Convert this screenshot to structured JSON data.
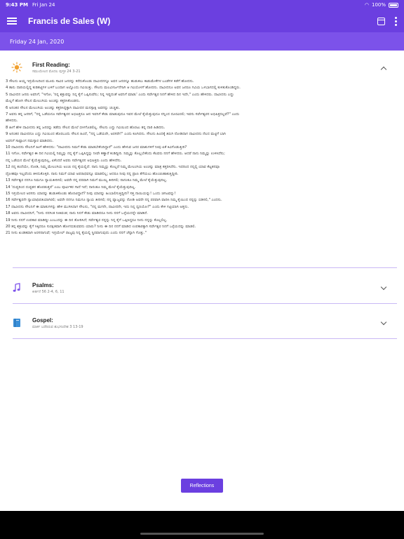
{
  "status": {
    "time": "9:43 PM",
    "date": "Fri Jan 24",
    "battery": "100%",
    "wifi": "◠"
  },
  "appbar": {
    "title": "Francis de Sales (W)"
  },
  "datebar": {
    "label": "Friday 24 Jan, 2020"
  },
  "sections": [
    {
      "title": "First Reading:",
      "subtitle": "ಸಮುಯೇಲನ ಮೊದಲ ಪುಸ್ತಕ 24 3-21",
      "expanded": true
    },
    {
      "title": "Psalms:",
      "subtitle": "ಕೀರ್ತನೆ 56 2-4, 6, 11",
      "expanded": false
    },
    {
      "title": "Gospel:",
      "subtitle": "ಮಾರ್ಕ ಬರೆದಿರುವ ಶುಭಸಂದೇಶ 3 13-19",
      "expanded": false
    }
  ],
  "reading_lines": [
    "3 ಸೌಲನು ಆಯ್ದ ಇಸ್ರಯೇಲರಿಂದ ಮೂರು ಸಾವಿರ ಜನರನ್ನು ಕರೆದುಕೊಂಡು ದಾವೀದನನ್ನೂ ಅವನ ಜನರನ್ನೂ ಹುಡುಕಲು ಕಾಡುಮೇಕೆಗಳ ಬಂಡೆಗಳ ಕಡೆಗೆ ಹೋದನು.",
    "4 ತಾನು ದಾರಿಯಲ್ಲಿದ್ದ ಕುರಿಹಟ್ಟಿಗಳ ಬಳಿಗೆ ಬಂದಾಗ ಅಲ್ಲೊಂದು ಗವಿಯಿತ್ತು. ಸೌಲನು ಮಲವಿಸರ್ಜನೆಗಾಗಿ ಆ ಗವಿಯೊಳಗೆ ಹೋದನು. ದಾವೀದನೂ ಅವನ ಜನರೂ ಗವಿಯ ಒಳಭಾಗದಲ್ಲಿ ಕುಳಿತುಕೊಂಡಿದ್ದರು.",
    "5 ದಾವೀದನ ಜನರು ಅವನಿಗೆ, \"ಇಗೋ, 'ನಿನ್ನ ಶತ್ರುವನ್ನು ನಿನ್ನ ಕೈಗೆ ಒಪ್ಪಿಸುವೆನು; ನಿನ್ನ ಇಷ್ಟದಂತೆ ಅವನಿಗೆ ಮಾಡು' ಎಂದು ಸರ್ವೇಶ್ವರ ನಿನಗೆ ಹೇಳಿದ ದಿನ ಇದೇ,\" ಎಂದು ಹೇಳಿದರು. ದಾವೀದನು ಎದ್ದು",
    "ಮೆಲ್ಲಗೆ ಹೋಗಿ ಸೌಲನ ಮೇಲಂಗಿಯ ಅಂಚನ್ನು ಕತ್ತರಿಸಿಕೊಂಡನು.",
    "6 ಅನಂತರ ಸೌಲನ ಮೇಲಂಗಿಯ ಅಂಚನ್ನು ಕತ್ತರಿಸಿದ್ದಕ್ಕಾಗಿ ದಾವೀದನ ಮನಸ್ಸಾಕ್ಷಿ ಅವನನ್ನು ಚುಚ್ಚಿತು.",
    "7 ಅವನು ತನ್ನ ಜನರಿಗೆ, \"ನನ್ನ ಒಡೆಯನೂ ಸರ್ವೇಶ್ವರನ ಅಭಿಷಿಕ್ತನೂ ಆದ ಇವನಿಗೆ ಕೇಡು ಮಾಡುವುದೂ ಇವನ ಮೇಲೆ ಕೈಯೆತ್ತುವುದೂ ನನ್ನಿಂದ ದೂರವಿರಲಿ; ಇವನು ಸರ್ವೇಶ್ವರನ ಅಭಿಷಿಕ್ತನಲ್ಲವೆ?\" ಎಂದು",
    "ಹೇಳಿದನು.",
    "8 ಹೀಗೆ ಹೇಳಿ ದಾವೀದನು ತನ್ನ ಜನರನ್ನು ತಡೆದು ಸೌಲನ ಮೇಲೆ ಬೀಳಗೊಡಲಿಲ್ಲ. ಸೌಲನು ಎದ್ದು ಗವಿಯಿಂದ ಹೊರಟು ತನ್ನ ದಾರಿ ಹಿಡಿದನು.",
    "9 ಅನಂತರ ದಾವೀದನೂ ಎದ್ದು ಗವಿಯಿಂದ ಹೊರಬಂದು ಸೌಲನ ಹಿಂದೆ, \"ನನ್ನ ಒಡೆಯರೇ, ಅರಸರೇ!\" ಎಂದು ಕೂಗಿದನು. ಸೌಲನು ಹಿಂದಕ್ಕೆ ತಿರುಗಿ ನೋಡಿದಾಗ ದಾವೀದನು ನೆಲದ ಮಟ್ಟಿಗೆ ಬಾಗಿ",
    "ಅವನಿಗೆ ಸಾಷ್ಟಾಂಗ ನಮಸ್ಕಾರ ಮಾಡಿದನು.",
    "10 ದಾವೀದನು ಸೌಲನಿಗೆ ಹೀಗೆ ಹೇಳಿದನು: \"ದಾವೀದನು ನಿಮಗೆ ಕೇಡು ಮಾಡಬೇಕೆಂದಿದ್ದಾನೆ\" ಎಂದು ಹೇಳುವ ಜನರ ಮಾತುಗಳಿಗೆ ನೀವು ಏಕೆ ಕಿವಿಗೊಡುತ್ತೀರಿ?",
    "11 ಇಗೋ, ಸರ್ವೇಶ್ವರ ಈ ದಿನ ಗವಿಯಲ್ಲಿ ನಿಮ್ಮನ್ನು ನನ್ನ ಕೈಗೆ ಒಪ್ಪಿಸಿದ್ದನ್ನು ನೀವೇ ಕಣ್ಣಾರೆ ಕಂಡಿದ್ದೀರಿ. ನಿಮ್ಮನ್ನು ಕೊಲ್ಲಬೇಕೆಂದು ಕೆಲವರು ನನಗೆ ಹೇಳಿದರು. ಆದರೆ ನಾನು ನಿಮ್ಮನ್ನು ಉಳಿಸಿದೆನು;",
    "ನನ್ನ ಒಡೆಯನ ಮೇಲೆ ಕೈಯೆತ್ತುವುದಿಲ್ಲ, ಏಕೆಂದರೆ ಅವರು ಸರ್ವೇಶ್ವರನ ಅಭಿಷಿಕ್ತರು ಎಂದು ಹೇಳಿದೆನು.",
    "12 ನನ್ನ ತಂದೆಯೇ, ನೋಡಿ, ನಿಮ್ಮ ಮೇಲಂಗಿಯ ಅಂಚು ನನ್ನ ಕೈಯಲ್ಲಿದೆ. ನಾನು ನಿಮ್ಮನ್ನು ಕೊಲ್ಲದೆ ನಿಮ್ಮ ಮೇಲಂಗಿಯ ಅಂಚನ್ನು ಮಾತ್ರ ಕತ್ತರಿಸಿದೆನು. ಇದರಿಂದ ನನ್ನಲ್ಲಿ ಯಾವ ಕೆಟ್ಟತನವೂ",
    "ದ್ರೋಹವೂ ಇಲ್ಲವೆಂದು ತಿಳಿದುಕೊಳ್ಳಿರಿ. ನಾನು ನಿಮಗೆ ಯಾವ ಅಪರಾಧವನ್ನೂ ಮಾಡಲಿಲ್ಲ; ಆದರೂ ನೀವು ನನ್ನ ಪ್ರಾಣ ತೆಗೆಯಲು ಹೊಂಚುಹಾಕುತ್ತಿದ್ದೀರಿ.",
    "13 ಸರ್ವೇಶ್ವರ ನನಗೂ ನಿಮಗೂ ನ್ಯಾಯತೀರಿಸಲಿ; ಅವರೇ ನನ್ನ ಪರವಾಗಿ ನಿಮಗೆ ಮುಯ್ಯಿ ತೀರಿಸಲಿ; ನಾನಂತೂ ನಿಮ್ಮ ಮೇಲೆ ಕೈಯೆತ್ತುವುದಿಲ್ಲ.",
    "14 'ದುಷ್ಟರಿಂದ ದುಷ್ಟತನ ಹೊರಡುತ್ತದೆ' ಎಂಬ ಪೂರ್ವಿಕರ ಗಾದೆ ಇದೆ; ನಾನಂತೂ ನಿಮ್ಮ ಮೇಲೆ ಕೈಯೆತ್ತುವುದಿಲ್ಲ.",
    "15 ಇಸ್ರಯೇಲರ ಅರಸನು ಯಾರನ್ನು ಹುಡುಕಿಕೊಂಡು ಹೊರಟಿದ್ದಾನೆ? ನೀವು ಯಾರನ್ನು ಹಿಂಬಾಲಿಸುತ್ತಿದ್ದೀರಿ? ಸತ್ತ ನಾಯಿಯನ್ನು! ಒಂದು ಚಿಗಟವನ್ನು!",
    "16 ಸರ್ವೇಶ್ವರನೇ ನ್ಯಾಯಾಧಿಪತಿಯಾಗಿರಲಿ; ಅವರೇ ನನಗೂ ನಿಮಗೂ ನ್ಯಾಯ ತೀರಿಸಲಿ; ನನ್ನ ವ್ಯಾಜ್ಯವನ್ನು ನೋಡಿ ಅವರೇ ನನ್ನ ಪರವಾಗಿ ವಾದಿಸಿ ನಿಮ್ಮ ಕೈಯಿಂದ ನನ್ನನ್ನು ಬಿಡಿಸಲಿ,\" ಎಂದನು.",
    "17 ದಾವೀದನು ಸೌಲನಿಗೆ ಈ ಮಾತುಗಳನ್ನು ಹೇಳಿ ಮುಗಿಸಿದಾಗ ಸೌಲನು, \"ನನ್ನ ಮಗನೇ, ದಾವೀದನೇ, ಇದು ನಿನ್ನ ಧ್ವನಿಯೋ?\" ಎಂದು ಕೇಳಿ ಗಟ್ಟಿಯಾಗಿ ಅತ್ತನು.",
    "18 ಅವನು ದಾವೀದನಿಗೆ, \"ನೀನು ನನಗಿಂತ ನೀತಿವಂತ; ನಾನು ನಿನಗೆ ಕೇಡು ಮಾಡಿದರೂ ನೀನು ನನಗೆ ಒಳ್ಳೆಯದನ್ನೇ ಮಾಡಿದೆ.",
    "19 ನೀನು ನನಗೆ ಉಪಕಾರ ಮಾಡಿದ್ದೀ ಎಂಬುದನ್ನು ಈ ದಿನ ತೋರಿಸಿದೆ; ಸರ್ವೇಶ್ವರ ನನ್ನನ್ನು ನಿನ್ನ ಕೈಗೆ ಒಪ್ಪಿಸಿದ್ದರೂ ನೀನು ನನ್ನನ್ನು ಕೊಲ್ಲಲಿಲ್ಲ.",
    "20 ತನ್ನ ಶತ್ರುವನ್ನು ಕೈಗೆ ಸಿಕ್ಕಿದರೂ ಸುರಕ್ಷಿತವಾಗಿ ಹೋಗಬಿಡುವವನು ಯಾರು? ನೀನು ಈ ದಿನ ನನಗೆ ಮಾಡಿದ ಉಪಕಾರಕ್ಕಾಗಿ ಸರ್ವೇಶ್ವರ ನಿನಗೆ ಒಳ್ಳೆಯದನ್ನು ಮಾಡಲಿ.",
    "21 ನೀನು ಖಂಡಿತವಾಗಿ ಅರಸನಾಗುವೆ; ಇಸ್ರಯೇಲ್ ರಾಜ್ಯವು ನಿನ್ನ ಕೈಯಲ್ಲಿ ಸ್ಥಿರವಾಗುವುದು ಎಂದು ನನಗೆ ಚೆನ್ನಾಗಿ ಗೊತ್ತು.\""
  ],
  "buttons": {
    "reflections": "Reflections"
  },
  "colors": {
    "primary": "#6b3fe0",
    "datebar": "#7c52ea",
    "divider": "#c9b8f5"
  }
}
